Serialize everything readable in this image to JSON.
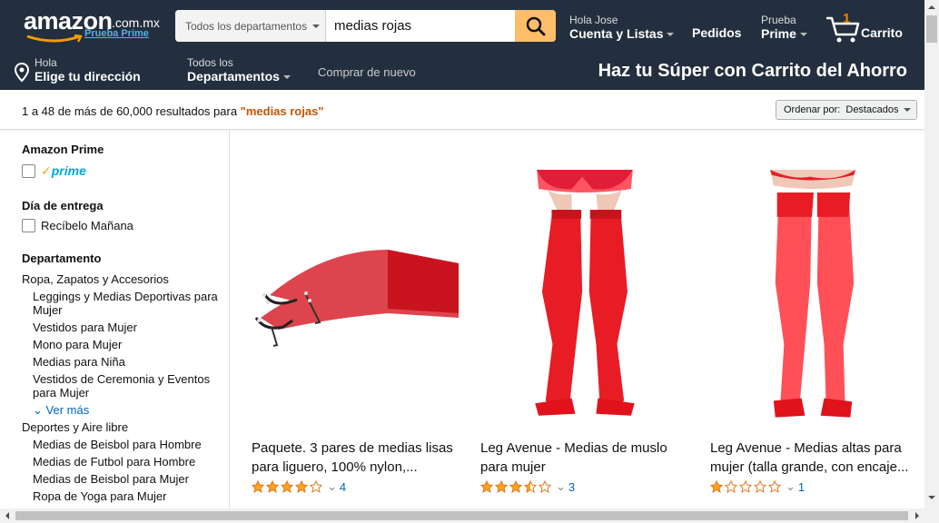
{
  "header": {
    "logo_text": "amazon",
    "logo_tld": ".com.mx",
    "logo_prime": "Prueba Prime",
    "search_department": "Todos los departamentos",
    "search_value": "medias rojas",
    "account_line1": "Hola Jose",
    "account_line2": "Cuenta y Listas",
    "orders": "Pedidos",
    "prime_line1": "Prueba",
    "prime_line2": "Prime",
    "cart_count": "1",
    "cart_label": "Carrito"
  },
  "subnav": {
    "address_line1": "Hola",
    "address_line2": "Elige tu dirección",
    "departments_line1": "Todos los",
    "departments_line2": "Departamentos",
    "buy_again": "Comprar de nuevo",
    "promo": "Haz tu Súper con Carrito del Ahorro"
  },
  "results": {
    "summary": "1 a 48 de más de 60,000 resultados para ",
    "query": "\"medias rojas\"",
    "sort_label": "Ordenar por:",
    "sort_value": "Destacados"
  },
  "sidebar": {
    "prime_heading": "Amazon Prime",
    "prime_badge": "prime",
    "delivery_heading": "Día de entrega",
    "delivery_option": "Recíbelo Mañana",
    "department_heading": "Departamento",
    "departments": [
      {
        "label": "Ropa, Zapatos y Accesorios",
        "level": 0
      },
      {
        "label": "Leggings y Medias Deportivas para Mujer",
        "level": 1
      },
      {
        "label": "Vestidos para Mujer",
        "level": 1
      },
      {
        "label": "Mono para Mujer",
        "level": 1
      },
      {
        "label": "Medias para Niña",
        "level": 1
      },
      {
        "label": "Vestidos de Ceremonia y Eventos para Mujer",
        "level": 1
      },
      {
        "label": "Ver más",
        "level": 2
      },
      {
        "label": "Deportes y Aire libre",
        "level": 0
      },
      {
        "label": "Medias de Beisbol para Hombre",
        "level": 1
      },
      {
        "label": "Medias de Futbol para Hombre",
        "level": 1
      },
      {
        "label": "Medias de Beisbol para Mujer",
        "level": 1
      },
      {
        "label": "Ropa de Yoga para Mujer",
        "level": 1
      }
    ]
  },
  "products": [
    {
      "title": "Paquete. 3 pares de medias lisas para liguero, 100% nylon,...",
      "rating": 4,
      "reviews": "4"
    },
    {
      "title": "Leg Avenue - Medias de muslo para mujer",
      "rating": 3.5,
      "reviews": "3"
    },
    {
      "title": "Leg Avenue - Medias altas para mujer (talla grande, con encaje...",
      "rating": 1,
      "reviews": "1"
    }
  ],
  "colors": {
    "nav_bg": "#232f3e",
    "search_button": "#febd69",
    "query_orange": "#c45500",
    "link_blue": "#0066c0",
    "star": "#ffa41c",
    "stocking_red": "#e8101c"
  }
}
